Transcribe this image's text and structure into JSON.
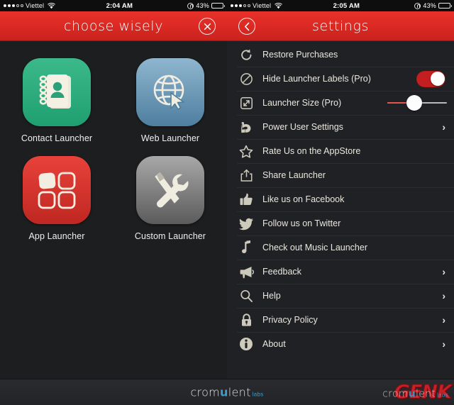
{
  "status_bar": {
    "carrier": "Viettel",
    "signal_filled_dots": 3,
    "signal_hollow_dots": 2,
    "wifi_icon": "wifi-icon",
    "time_left": "2:04 AM",
    "time_right": "2:05 AM",
    "rotation_lock_icon": "rotation-lock-icon",
    "battery_percent": "43%",
    "battery_level": 43
  },
  "left_pane": {
    "navbar": {
      "title": "choose wisely",
      "close_icon": "close-icon"
    },
    "launchers": [
      {
        "label": "Contact Launcher",
        "icon": "address-book-icon",
        "color": "#1f9f71",
        "style": "green"
      },
      {
        "label": "Web Launcher",
        "icon": "globe-cursor-icon",
        "color": "#4e7e9f",
        "style": "blue"
      },
      {
        "label": "App Launcher",
        "icon": "four-squares-icon",
        "color": "#bf2722",
        "style": "red"
      },
      {
        "label": "Custom Launcher",
        "icon": "hammer-wrench-icon",
        "color": "#5b5b5b",
        "style": "gray"
      }
    ]
  },
  "right_pane": {
    "navbar": {
      "title": "settings",
      "back_icon": "chevron-left-icon"
    },
    "rows": [
      {
        "label": "Restore Purchases",
        "icon": "refresh-icon",
        "control": "none"
      },
      {
        "label": "Hide Launcher Labels (Pro)",
        "icon": "no-entry-icon",
        "control": "toggle",
        "toggle_on": true
      },
      {
        "label": "Launcher Size (Pro)",
        "icon": "resize-icon",
        "control": "slider",
        "slider_value": 45
      },
      {
        "label": "Power User Settings",
        "icon": "bicep-icon",
        "control": "chevron"
      },
      {
        "label": "Rate Us on the AppStore",
        "icon": "star-icon",
        "control": "none"
      },
      {
        "label": "Share Launcher",
        "icon": "share-icon",
        "control": "none"
      },
      {
        "label": "Like us on Facebook",
        "icon": "thumbs-up-icon",
        "control": "none"
      },
      {
        "label": "Follow us on Twitter",
        "icon": "twitter-bird-icon",
        "control": "none"
      },
      {
        "label": "Check out Music Launcher",
        "icon": "music-note-icon",
        "control": "none"
      },
      {
        "label": "Feedback",
        "icon": "megaphone-icon",
        "control": "chevron"
      },
      {
        "label": "Help",
        "icon": "magnifier-icon",
        "control": "chevron"
      },
      {
        "label": "Privacy Policy",
        "icon": "lock-icon",
        "control": "chevron"
      },
      {
        "label": "About",
        "icon": "info-icon",
        "control": "chevron"
      }
    ],
    "chevron_glyph": "›"
  },
  "footer": {
    "watermark_prefix": "crom",
    "watermark_i": "u",
    "watermark_suffix": "lent",
    "watermark_sub": "labs",
    "genk_logo": "GENK"
  },
  "theme": {
    "accent_red": "#dd2a24",
    "toggle_on_red": "#c31f20",
    "slider_fill_red": "#e2564f",
    "bg_dark": "#1f2023",
    "text_cream": "#e9e7de"
  }
}
